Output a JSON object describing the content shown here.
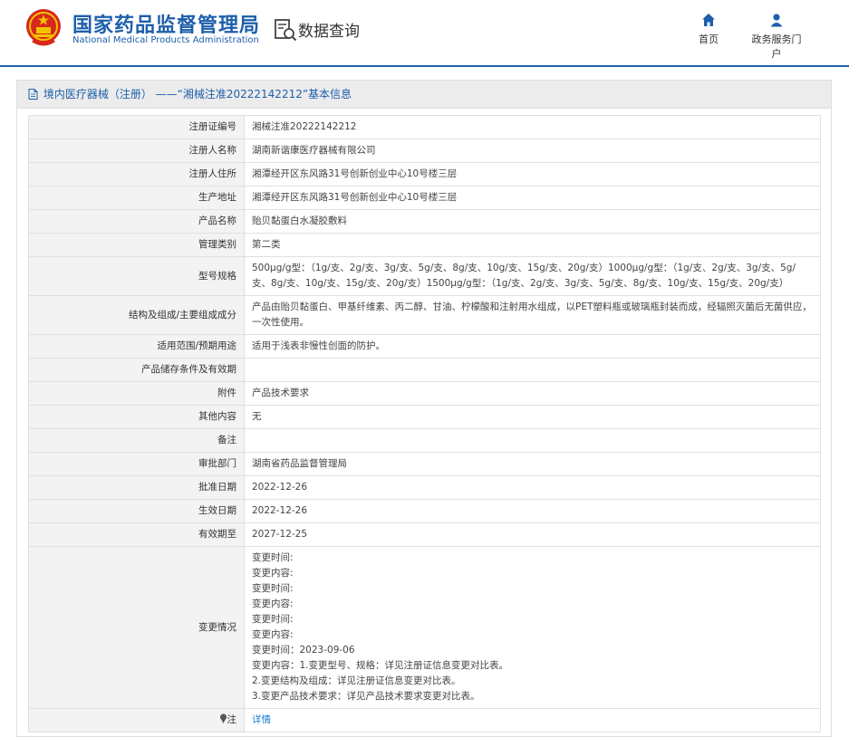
{
  "header": {
    "site_title": "国家药品监督管理局",
    "site_subtitle": "National Medical Products Administration",
    "section_label": "数据查询",
    "nav": [
      {
        "label": "首页",
        "icon": "home-icon"
      },
      {
        "label": "政务服务门户",
        "icon": "user-icon"
      }
    ],
    "colors": {
      "brand": "#1d5fab",
      "link": "#1d7ad7"
    }
  },
  "panel": {
    "title": "境内医疗器械（注册） ——“湘械注准20222142212”基本信息"
  },
  "fields": {
    "reg_no": {
      "label": "注册证编号",
      "value": "湘械注准20222142212"
    },
    "registrant": {
      "label": "注册人名称",
      "value": "湖南新谐康医疗器械有限公司"
    },
    "address": {
      "label": "注册人住所",
      "value": "湘潭经开区东风路31号创新创业中心10号楼三层"
    },
    "prod_address": {
      "label": "生产地址",
      "value": "湘潭经开区东风路31号创新创业中心10号楼三层"
    },
    "product_name": {
      "label": "产品名称",
      "value": "贻贝黏蛋白水凝胶敷料"
    },
    "category": {
      "label": "管理类别",
      "value": "第二类"
    },
    "model": {
      "label": "型号规格",
      "value": "500μg/g型：（1g/支、2g/支、3g/支、5g/支、8g/支、10g/支、15g/支、20g/支）1000μg/g型：（1g/支、2g/支、3g/支、5g/支、8g/支、10g/支、15g/支、20g/支）1500μg/g型：（1g/支、2g/支、3g/支、5g/支、8g/支、10g/支、15g/支、20g/支）"
    },
    "structure": {
      "label": "结构及组成/主要组成成分",
      "value": "产品由贻贝黏蛋白、甲基纤维素、丙二醇、甘油、柠檬酸和注射用水组成，以PET塑料瓶或玻璃瓶封装而成，经辐照灭菌后无菌供应，一次性使用。"
    },
    "scope": {
      "label": "适用范围/预期用途",
      "value": "适用于浅表非慢性创面的防护。"
    },
    "storage": {
      "label": "产品储存条件及有效期",
      "value": ""
    },
    "attachment": {
      "label": "附件",
      "value": "产品技术要求"
    },
    "other": {
      "label": "其他内容",
      "value": "无"
    },
    "remark": {
      "label": "备注",
      "value": ""
    },
    "approver": {
      "label": "审批部门",
      "value": "湖南省药品监督管理局"
    },
    "approve_date": {
      "label": "批准日期",
      "value": "2022-12-26"
    },
    "effective_date": {
      "label": "生效日期",
      "value": "2022-12-26"
    },
    "expiry_date": {
      "label": "有效期至",
      "value": "2027-12-25"
    },
    "changes": {
      "label": "变更情况",
      "lines": [
        "变更时间:",
        "变更内容:",
        "变更时间:",
        "变更内容:",
        "变更时间:",
        "变更内容:",
        "变更时间：2023-09-06",
        "变更内容：1.变更型号、规格：详见注册证信息变更对比表。",
        "2.变更结构及组成：详见注册证信息变更对比表。",
        "3.变更产品技术要求：详见产品技术要求变更对比表。"
      ]
    },
    "note": {
      "label": "注",
      "icon": "pin-icon",
      "link": "详情"
    }
  }
}
